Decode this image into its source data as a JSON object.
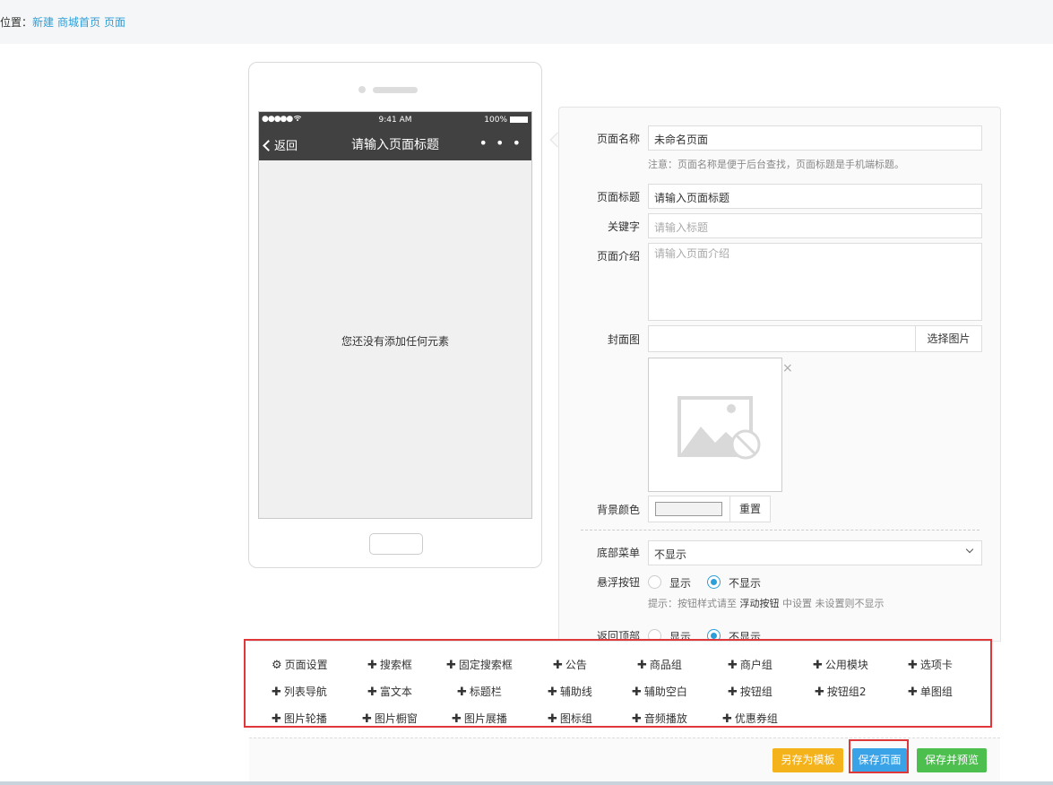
{
  "breadcrumb": {
    "prefix": "位置：",
    "items": [
      "新建",
      "商城首页",
      "页面"
    ]
  },
  "phone": {
    "signal": "●●●●● ",
    "time": "9:41 AM",
    "battery": "100%",
    "back_label": "返回",
    "title": "请输入页面标题",
    "more": "• • •",
    "empty_text": "您还没有添加任何元素"
  },
  "form": {
    "name_label": "页面名称",
    "name_value": "未命名页面",
    "name_hint": "注意：页面名称是便于后台查找，页面标题是手机端标题。",
    "title_label": "页面标题",
    "title_value": "请输入页面标题",
    "keyword_label": "关键字",
    "keyword_placeholder": "请输入标题",
    "intro_label": "页面介绍",
    "intro_placeholder": "请输入页面介绍",
    "cover_label": "封面图",
    "cover_button": "选择图片",
    "cover_close": "×",
    "bg_label": "背景颜色",
    "bg_reset": "重置",
    "menu_label": "底部菜单",
    "menu_value": "不显示",
    "float_label": "悬浮按钮",
    "show": "显示",
    "hide": "不显示",
    "float_hint_a": "提示：按钮样式请至 ",
    "float_hint_b": "浮动按钮",
    "float_hint_c": " 中设置 未设置则不显示",
    "top_label": "返回顶部"
  },
  "components": [
    [
      "页面设置",
      "搜索框",
      "固定搜索框",
      "公告",
      "商品组",
      "商户组",
      "公用模块",
      "选项卡"
    ],
    [
      "列表导航",
      "富文本",
      "标题栏",
      "辅助线",
      "辅助空白",
      "按钮组",
      "按钮组2",
      "单图组"
    ],
    [
      "图片轮播",
      "图片橱窗",
      "图片展播",
      "图标组",
      "音频播放",
      "优惠券组"
    ]
  ],
  "footer": {
    "template_button": "另存为模板",
    "save_button": "保存页面",
    "preview_button": "保存并预览"
  },
  "colors": {
    "link": "#2d9fd8",
    "highlight": "#e0373a",
    "template": "#f5b31b",
    "save": "#3aa3e8",
    "preview": "#4cbf4f"
  }
}
